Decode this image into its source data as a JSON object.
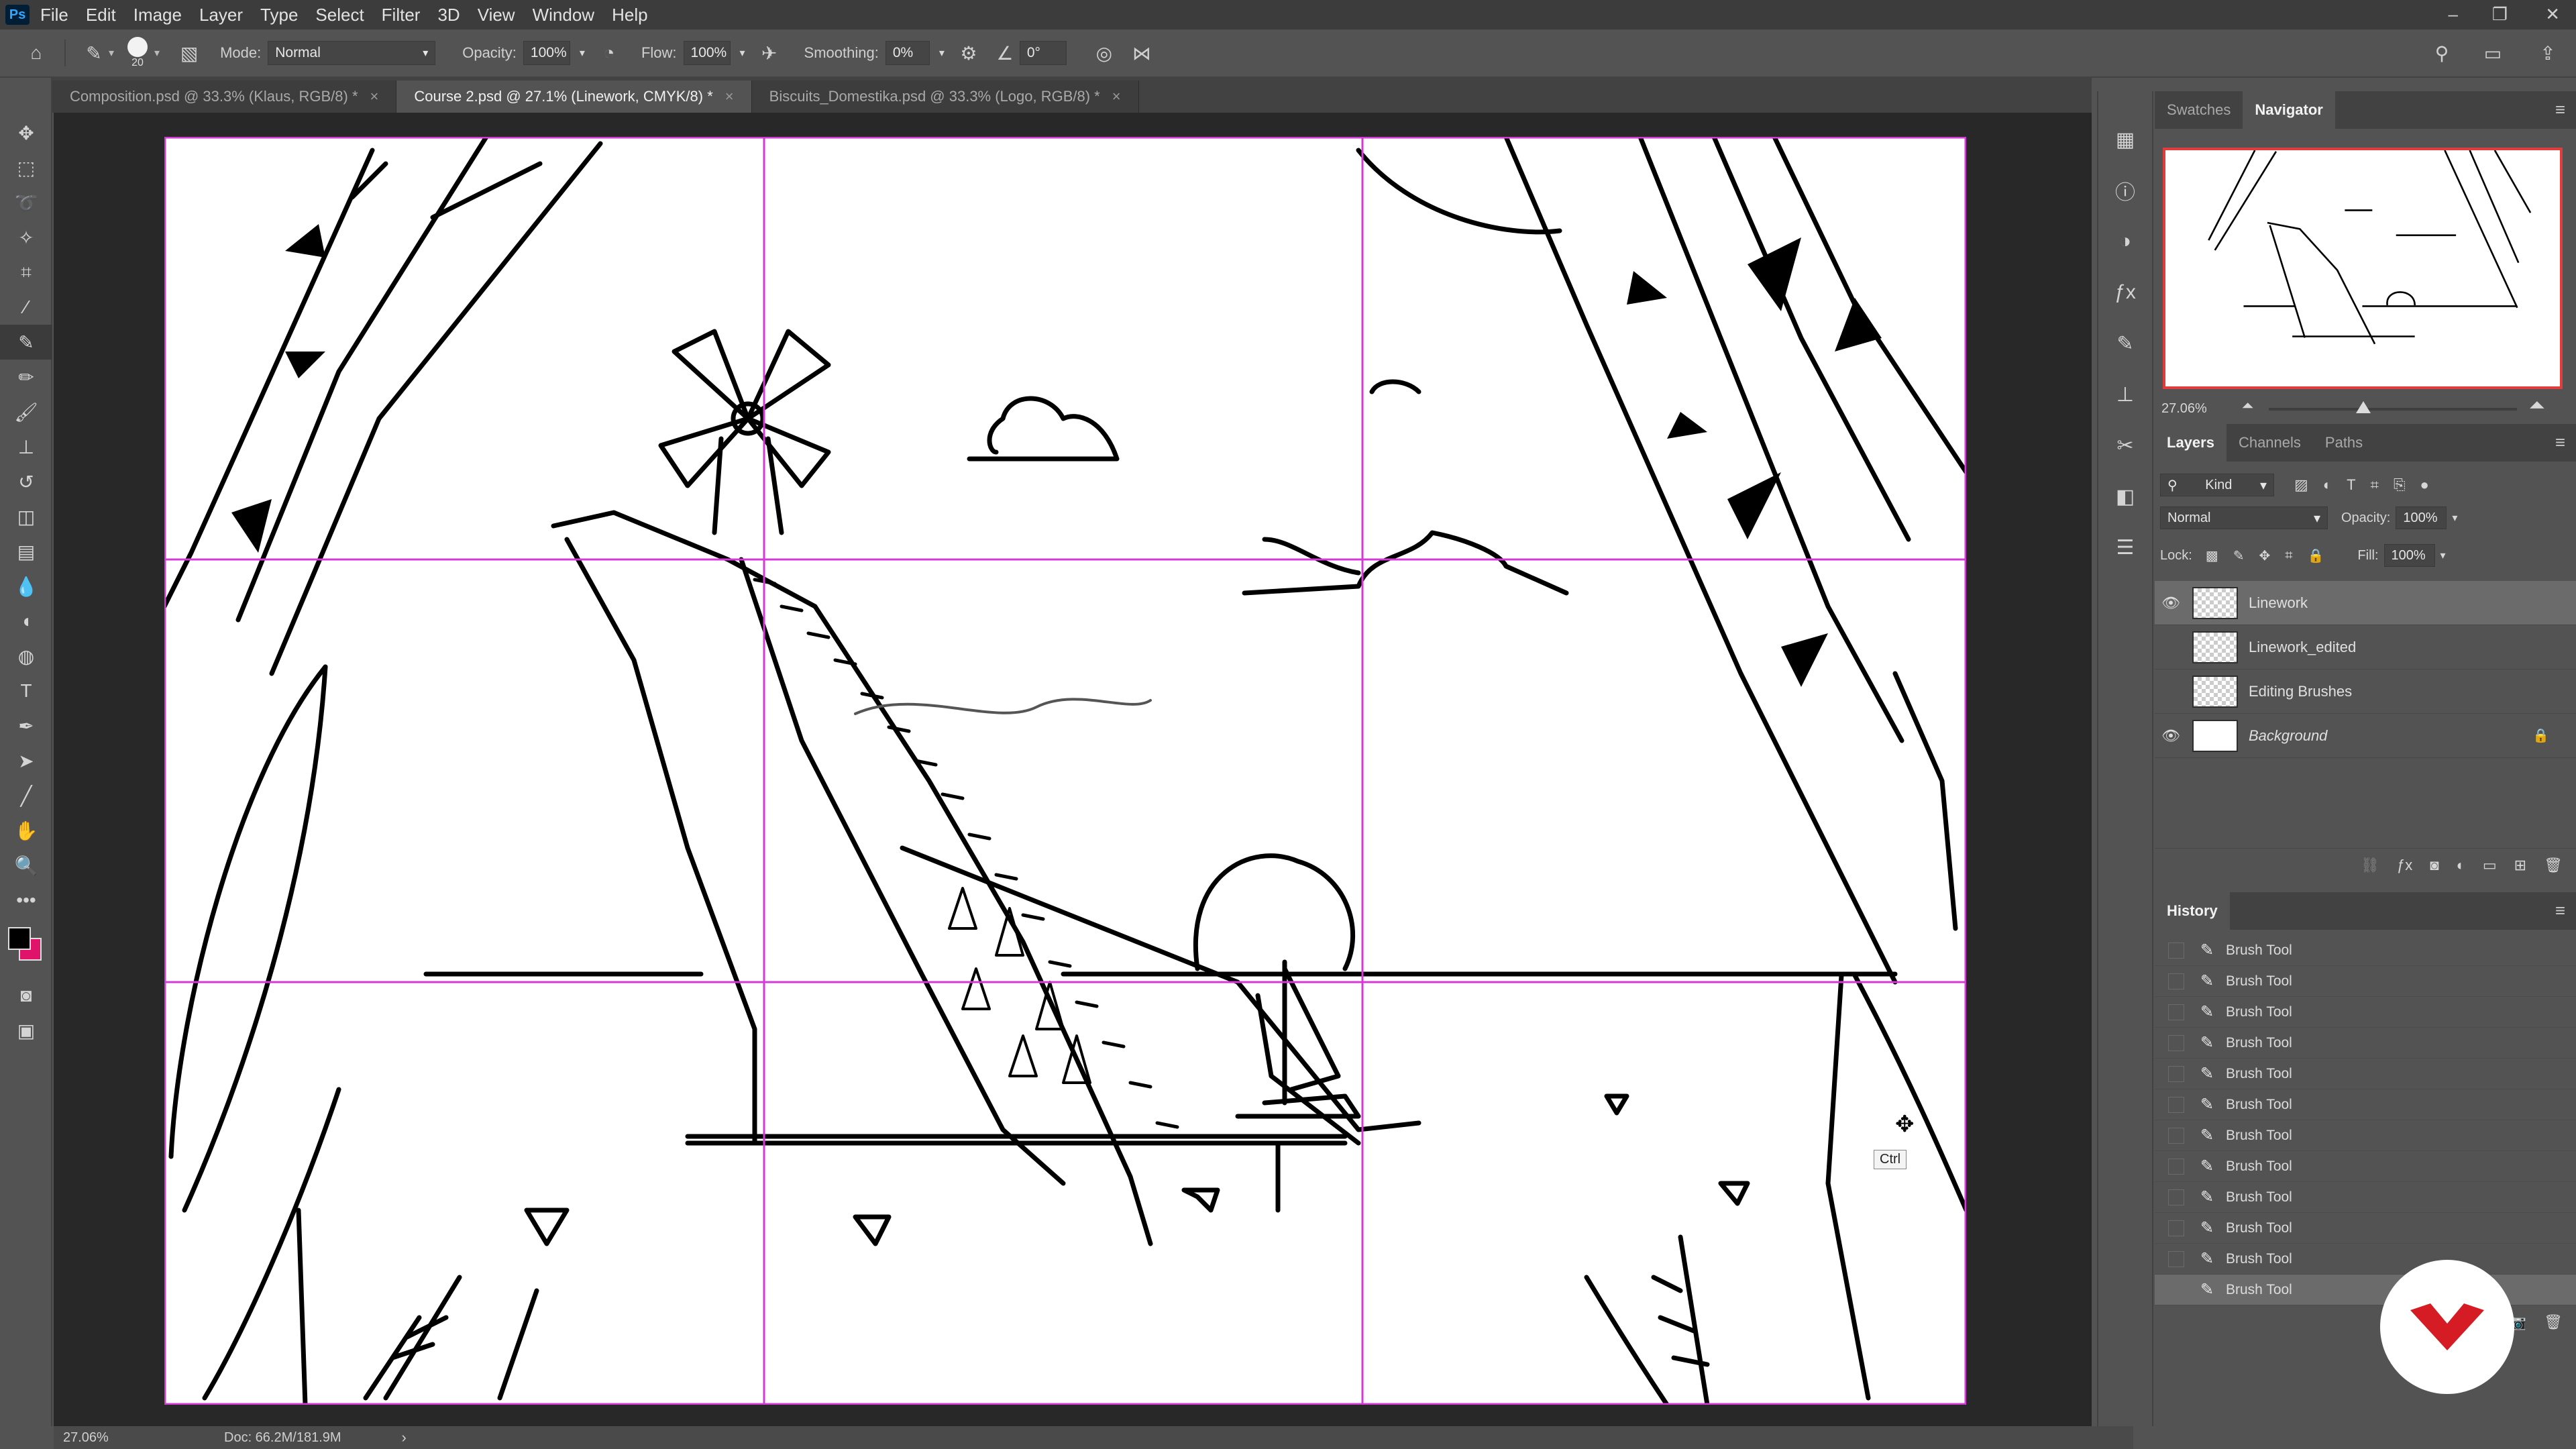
{
  "app": {
    "logo": "Ps",
    "menu": [
      "File",
      "Edit",
      "Image",
      "Layer",
      "Type",
      "Select",
      "Filter",
      "3D",
      "View",
      "Window",
      "Help"
    ],
    "window_controls": [
      "–",
      "❐",
      "✕"
    ]
  },
  "options_bar": {
    "brush_size": "20",
    "mode_label": "Mode:",
    "mode_value": "Normal",
    "opacity_label": "Opacity:",
    "opacity_value": "100%",
    "flow_label": "Flow:",
    "flow_value": "100%",
    "smoothing_label": "Smoothing:",
    "smoothing_value": "0%",
    "angle_value": "0°"
  },
  "tabs": [
    {
      "label": "Composition.psd @ 33.3% (Klaus, RGB/8) *",
      "close": "×",
      "active": false
    },
    {
      "label": "Course 2.psd @ 27.1% (Linework, CMYK/8) *",
      "close": "×",
      "active": true
    },
    {
      "label": "Biscuits_Domestika.psd @ 33.3% (Logo, RGB/8) *",
      "close": "×",
      "active": false
    }
  ],
  "tools": [
    {
      "name": "move-tool-icon",
      "glyph": "✥"
    },
    {
      "name": "marquee-tool-icon",
      "glyph": "⬚"
    },
    {
      "name": "lasso-tool-icon",
      "glyph": "➰"
    },
    {
      "name": "magic-wand-tool-icon",
      "glyph": "✧"
    },
    {
      "name": "crop-tool-icon",
      "glyph": "⌗"
    },
    {
      "name": "eyedropper-tool-icon",
      "glyph": "⁄"
    },
    {
      "name": "brush-tool-icon",
      "glyph": "✎",
      "active": true
    },
    {
      "name": "pencil-tool-icon",
      "glyph": "✏"
    },
    {
      "name": "mixer-brush-tool-icon",
      "glyph": "🖌"
    },
    {
      "name": "clone-stamp-tool-icon",
      "glyph": "⊥"
    },
    {
      "name": "history-brush-tool-icon",
      "glyph": "↺"
    },
    {
      "name": "eraser-tool-icon",
      "glyph": "◫"
    },
    {
      "name": "gradient-tool-icon",
      "glyph": "▤"
    },
    {
      "name": "blur-tool-icon",
      "glyph": "💧"
    },
    {
      "name": "dodge-tool-icon",
      "glyph": "◖"
    },
    {
      "name": "sponge-tool-icon",
      "glyph": "◍"
    },
    {
      "name": "type-tool-icon",
      "glyph": "T"
    },
    {
      "name": "pen-tool-icon",
      "glyph": "✒"
    },
    {
      "name": "path-selection-tool-icon",
      "glyph": "➤"
    },
    {
      "name": "line-tool-icon",
      "glyph": "╱"
    },
    {
      "name": "hand-tool-icon",
      "glyph": "✋"
    },
    {
      "name": "zoom-tool-icon",
      "glyph": "🔍"
    },
    {
      "name": "more-tools-icon",
      "glyph": "•••"
    }
  ],
  "canvas": {
    "cursor_tooltip": "Ctrl"
  },
  "status": {
    "zoom": "27.06%",
    "doc_size": "Doc: 66.2M/181.9M",
    "arrow": "›"
  },
  "navigator": {
    "tabs": [
      "Swatches",
      "Navigator"
    ],
    "zoom": "27.06%"
  },
  "layers_panel": {
    "tabs": [
      "Layers",
      "Channels",
      "Paths"
    ],
    "filter_kind": "Kind",
    "blend_mode": "Normal",
    "opacity_label": "Opacity:",
    "opacity_value": "100%",
    "lock_label": "Lock:",
    "fill_label": "Fill:",
    "fill_value": "100%",
    "layers": [
      {
        "name": "Linework",
        "visible": true,
        "selected": true
      },
      {
        "name": "Linework_edited",
        "visible": false,
        "selected": false
      },
      {
        "name": "Editing Brushes",
        "visible": false,
        "selected": false
      },
      {
        "name": "Background",
        "visible": true,
        "selected": false,
        "locked": true
      }
    ]
  },
  "history_panel": {
    "title": "History",
    "items": [
      "Brush Tool",
      "Brush Tool",
      "Brush Tool",
      "Brush Tool",
      "Brush Tool",
      "Brush Tool",
      "Brush Tool",
      "Brush Tool",
      "Brush Tool",
      "Brush Tool",
      "Brush Tool",
      "Brush Tool"
    ]
  },
  "colors": {
    "guide": "#d63ad6",
    "foreground": "#000000",
    "background_swatch": "#e0136a",
    "watermark": "#d51c24"
  }
}
